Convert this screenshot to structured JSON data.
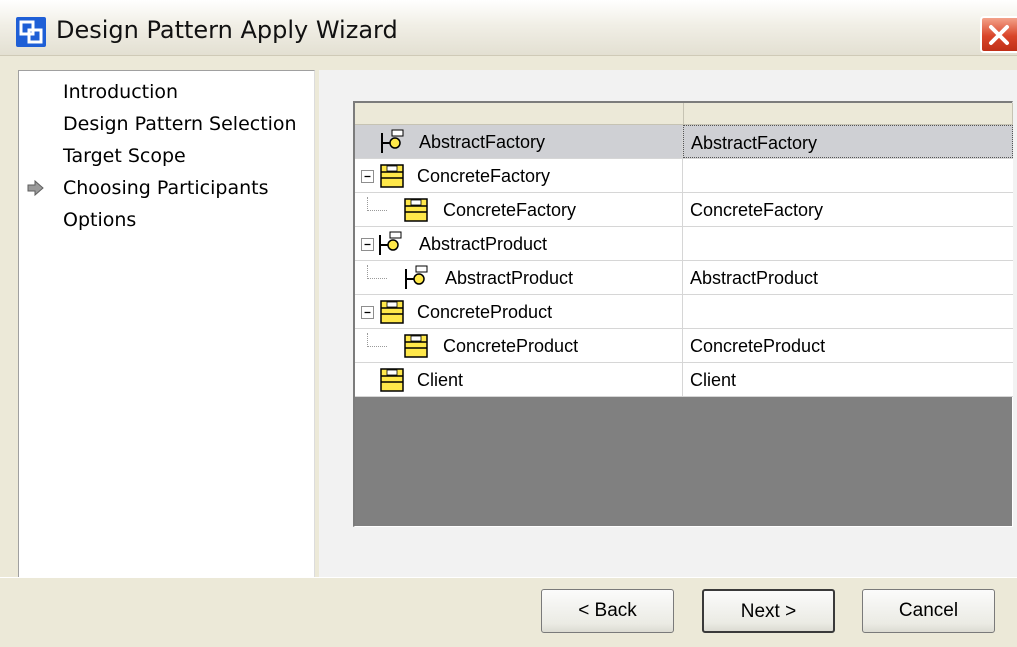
{
  "window": {
    "title": "Design Pattern Apply Wizard",
    "title_icon": "wizard-app-icon",
    "close_icon": "close-x-icon"
  },
  "steps": [
    {
      "label": "Introduction",
      "active": false
    },
    {
      "label": "Design Pattern Selection",
      "active": false
    },
    {
      "label": "Target Scope",
      "active": false
    },
    {
      "label": "Choosing Participants",
      "active": true
    },
    {
      "label": "Options",
      "active": false
    }
  ],
  "participants": {
    "columns": [
      "",
      ""
    ],
    "rows": [
      {
        "role": "AbstractFactory",
        "target": "AbstractFactory",
        "icon": "interface-icon",
        "level": 0,
        "expander": false,
        "selected": true
      },
      {
        "role": "ConcreteFactory",
        "target": "",
        "icon": "class-icon",
        "level": 0,
        "expander": true,
        "selected": false
      },
      {
        "role": "ConcreteFactory",
        "target": "ConcreteFactory",
        "icon": "class-icon",
        "level": 1,
        "expander": false,
        "selected": false
      },
      {
        "role": "AbstractProduct",
        "target": "",
        "icon": "interface-icon",
        "level": 0,
        "expander": true,
        "selected": false
      },
      {
        "role": "AbstractProduct",
        "target": "AbstractProduct",
        "icon": "interface-icon",
        "level": 1,
        "expander": false,
        "selected": false
      },
      {
        "role": "ConcreteProduct",
        "target": "",
        "icon": "class-icon",
        "level": 0,
        "expander": true,
        "selected": false
      },
      {
        "role": "ConcreteProduct",
        "target": "ConcreteProduct",
        "icon": "class-icon",
        "level": 1,
        "expander": false,
        "selected": false
      },
      {
        "role": "Client",
        "target": "Client",
        "icon": "class-icon",
        "level": 0,
        "expander": false,
        "selected": false
      }
    ]
  },
  "buttons": {
    "back": "< Back",
    "next": "Next >",
    "cancel": "Cancel"
  },
  "colors": {
    "title_icon": "#1f5fd6",
    "close_button": "#d9452a",
    "class_icon_fill": "#ffe84a",
    "grid_background": "#808080",
    "selected_row": "#cfd0d4"
  }
}
